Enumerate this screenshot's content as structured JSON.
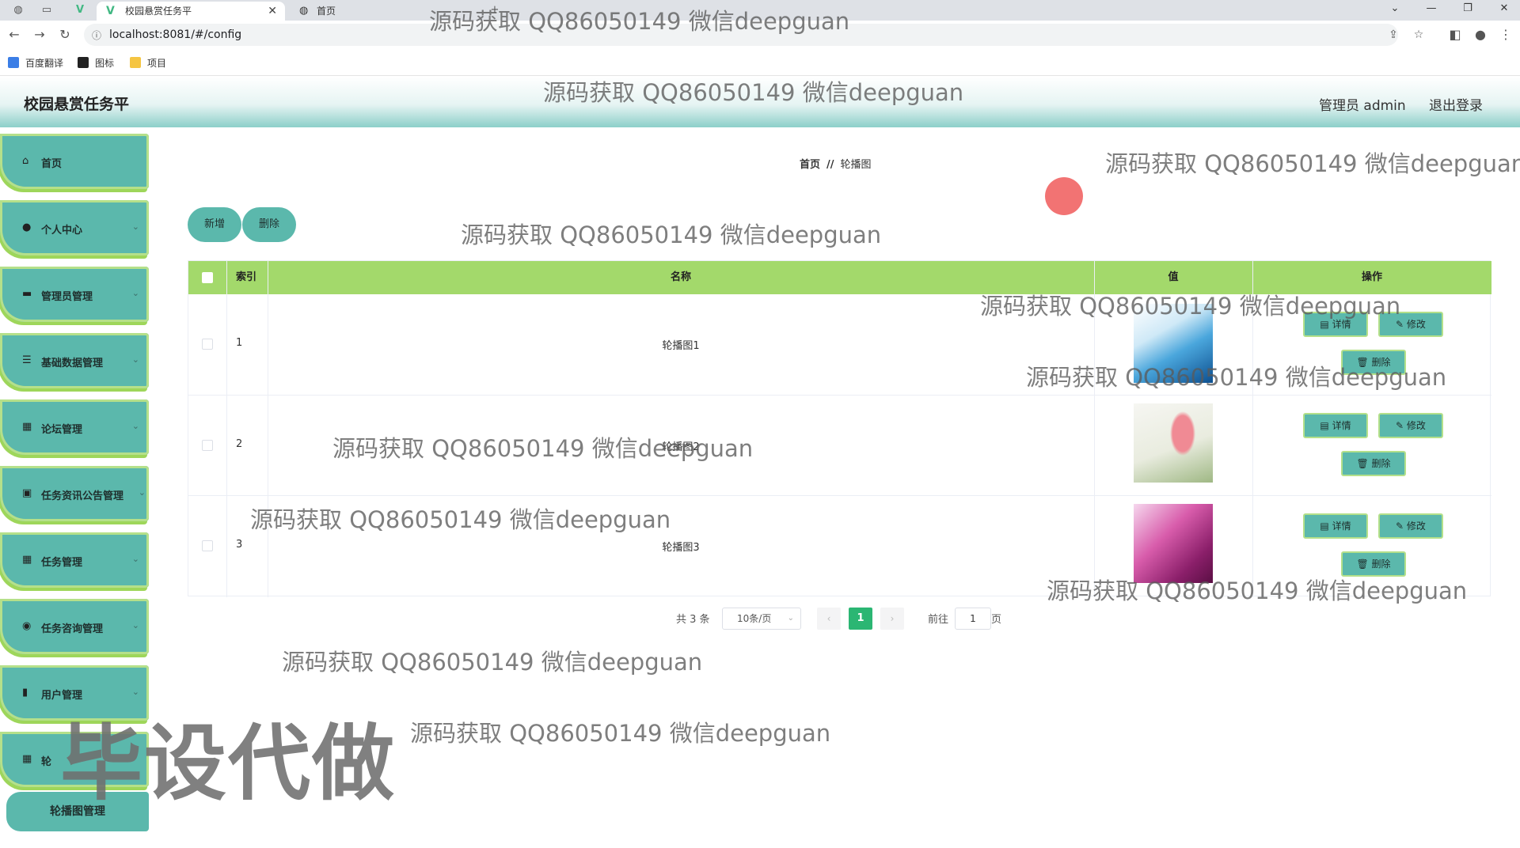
{
  "browser": {
    "active_tab_title": "校园悬赏任务平",
    "inactive_tab_title": "首页",
    "url": "localhost:8081/#/config",
    "bookmarks": [
      "百度翻译",
      "图标",
      "项目"
    ],
    "icons": [
      "back-icon",
      "forward-icon",
      "reload-icon",
      "share-icon",
      "star-icon",
      "sidepanel-icon",
      "profile-icon",
      "menu-icon"
    ]
  },
  "header": {
    "title": "校园悬赏任务平",
    "admin_label": "管理员 admin",
    "logout_label": "退出登录",
    "colors": {
      "header_gradient_end": "#8ccfc9"
    }
  },
  "sidebar": {
    "items": [
      {
        "label": "首页",
        "icon": "home-icon"
      },
      {
        "label": "个人中心",
        "icon": "user-icon"
      },
      {
        "label": "管理员管理",
        "icon": "chat-icon"
      },
      {
        "label": "基础数据管理",
        "icon": "list-icon"
      },
      {
        "label": "论坛管理",
        "icon": "grid-icon"
      },
      {
        "label": "任务资讯公告管理",
        "icon": "clipboard-icon"
      },
      {
        "label": "任务管理",
        "icon": "grid-icon"
      },
      {
        "label": "任务咨询管理",
        "icon": "location-icon"
      },
      {
        "label": "用户管理",
        "icon": "bar-chart-icon"
      },
      {
        "label": "轮",
        "icon": "grid-icon"
      }
    ],
    "sub_item": "轮播图管理",
    "colors": {
      "item_bg": "#5bb8ac",
      "item_border": "#9ed65a"
    }
  },
  "breadcrumb": {
    "home": "首页",
    "sep": "//",
    "current": "轮播图"
  },
  "toolbar": {
    "add_label": "新增",
    "delete_label": "删除"
  },
  "table": {
    "headers": {
      "index": "索引",
      "name": "名称",
      "value": "值",
      "actions": "操作"
    },
    "rows": [
      {
        "index": "1",
        "name": "轮播图1",
        "image": "blue-wave"
      },
      {
        "index": "2",
        "name": "轮播图2",
        "image": "pink-balloon"
      },
      {
        "index": "3",
        "name": "轮播图3",
        "image": "purple-silk"
      }
    ],
    "action_labels": {
      "detail": "详情",
      "edit": "修改",
      "delete": "删除"
    },
    "colors": {
      "header_bg": "#a3d96b",
      "button_bg": "#5bb8ac"
    }
  },
  "pagination": {
    "total_label": "共 3 条",
    "page_size": "10条/页",
    "current_page": "1",
    "goto_label": "前往",
    "goto_value": "1",
    "page_unit": "页"
  },
  "watermarks": {
    "text": "源码获取 QQ86050149 微信deepguan",
    "big_text": "毕设代做"
  }
}
